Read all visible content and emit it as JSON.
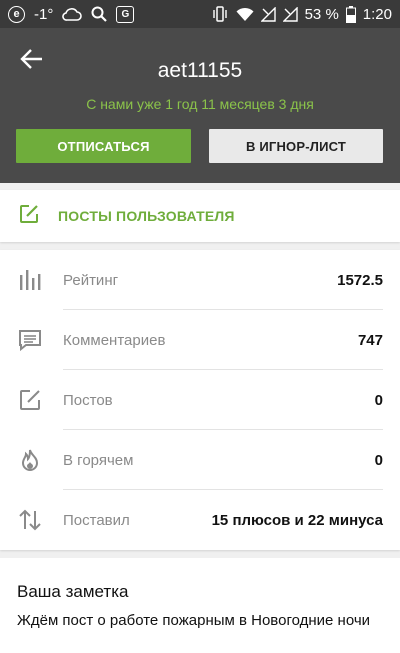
{
  "status_bar": {
    "left_icons": [
      "e-icon",
      "temperature-icon",
      "cloud-icon",
      "search-icon",
      "translate-icon"
    ],
    "temperature": "-1°",
    "battery": "53 %",
    "time": "1:20"
  },
  "profile": {
    "username": "aet11155",
    "since": "С нами уже 1 год 11 месяцев 3 дня",
    "unsubscribe_label": "ОТПИСАТЬСЯ",
    "ignore_label": "В ИГНОР-ЛИСТ"
  },
  "posts_link": {
    "label": "ПОСТЫ ПОЛЬЗОВАТЕЛЯ"
  },
  "stats": [
    {
      "icon": "bar-chart-icon",
      "label": "Рейтинг",
      "value": "1572.5"
    },
    {
      "icon": "comment-icon",
      "label": "Комментариев",
      "value": "747"
    },
    {
      "icon": "edit-icon",
      "label": "Постов",
      "value": "0"
    },
    {
      "icon": "flame-icon",
      "label": "В горячем",
      "value": "0"
    },
    {
      "icon": "up-down-arrows-icon",
      "label": "Поставил",
      "value": "15 плюсов и 22 минуса"
    }
  ],
  "note": {
    "title": "Ваша заметка",
    "text": "Ждём пост о работе пожарным в Новогодние ночи"
  },
  "colors": {
    "accent": "#6fad3b",
    "header_bg": "#4a4a4a",
    "status_bg": "#3a3a3a"
  }
}
